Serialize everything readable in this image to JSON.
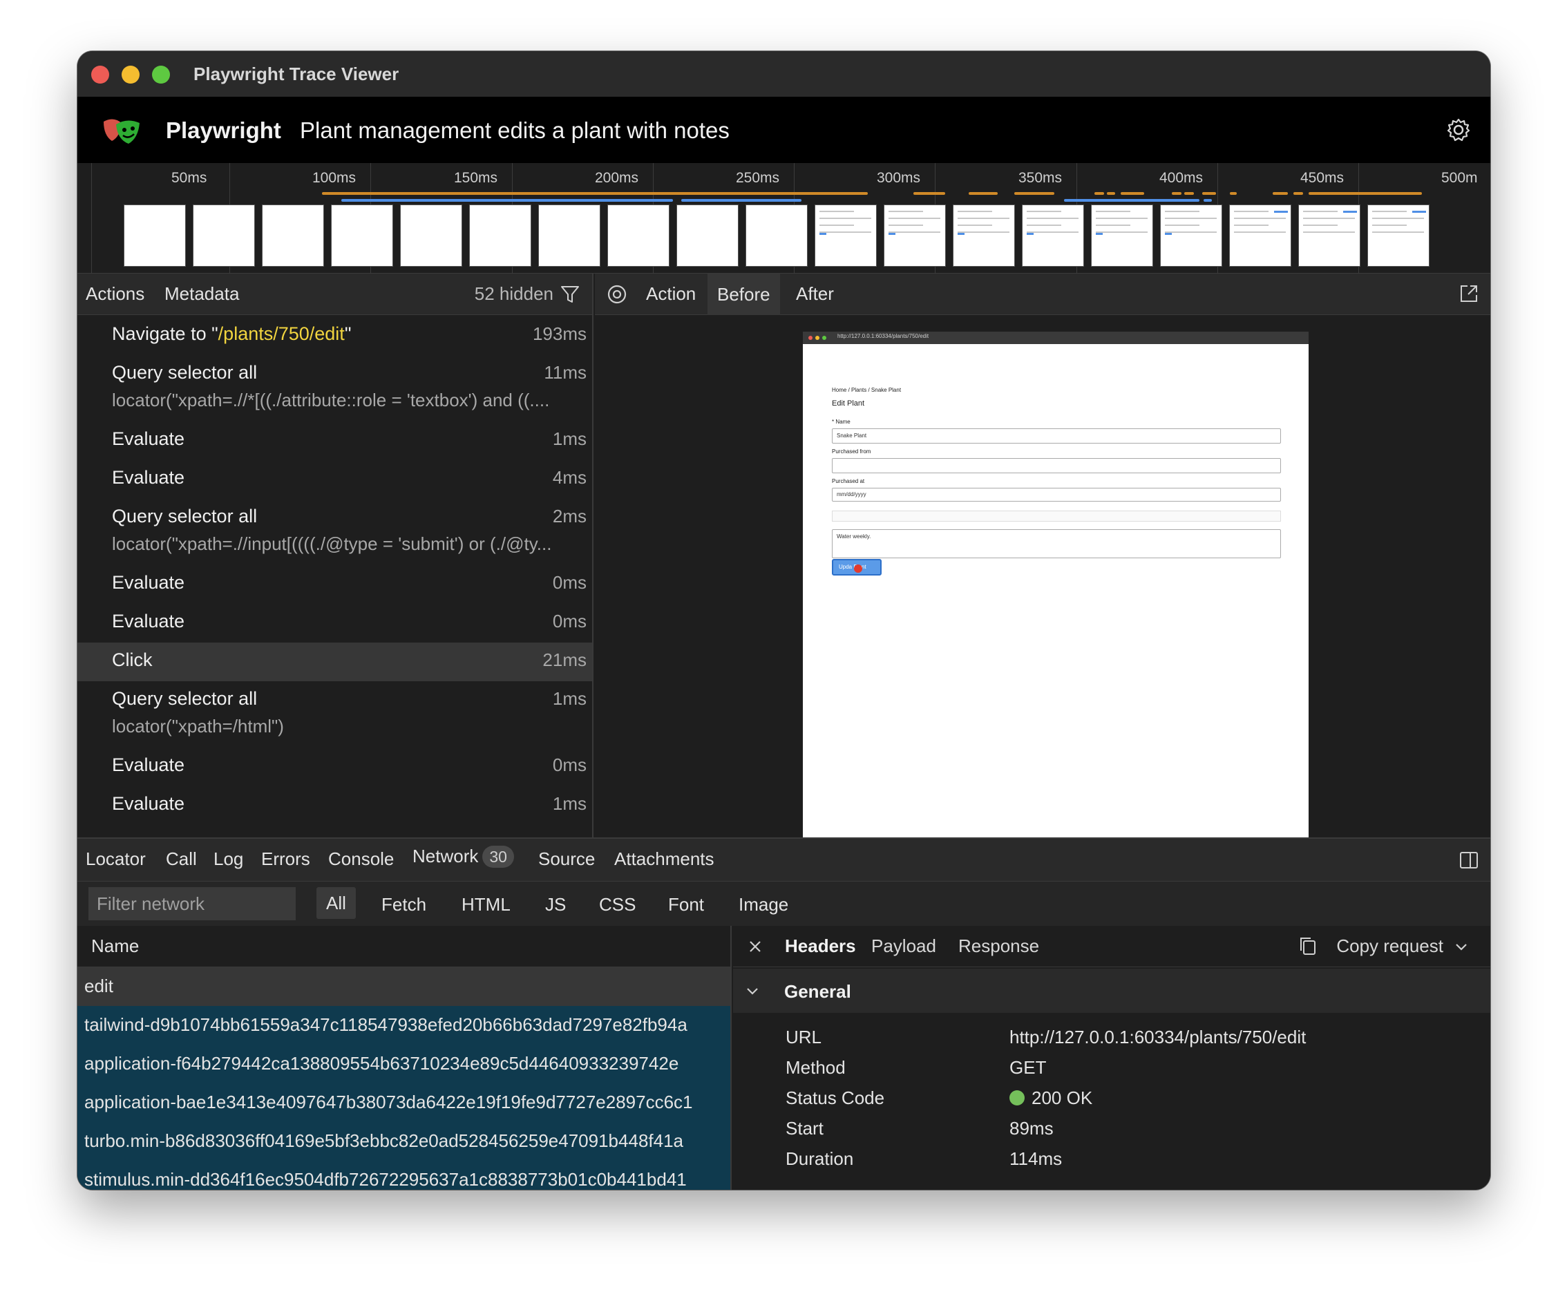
{
  "window": {
    "title": "Playwright Trace Viewer"
  },
  "header": {
    "brand": "Playwright",
    "test_title": "Plant management edits a plant with notes"
  },
  "timeline": {
    "ticks": [
      "50ms",
      "100ms",
      "150ms",
      "200ms",
      "250ms",
      "300ms",
      "350ms",
      "400ms",
      "450ms",
      "500m"
    ]
  },
  "left_tabs": {
    "actions": "Actions",
    "metadata": "Metadata",
    "hidden": "52 hidden"
  },
  "actions": [
    {
      "name_prefix": "Navigate to \"",
      "name_highlight": "/plants/750/edit",
      "name_suffix": "\"",
      "duration": "193ms"
    },
    {
      "name": "Query selector all",
      "duration": "11ms",
      "sub": "locator(\"xpath=.//*[((./attribute::role = 'textbox') and ((...."
    },
    {
      "name": "Evaluate",
      "duration": "1ms"
    },
    {
      "name": "Evaluate",
      "duration": "4ms"
    },
    {
      "name": "Query selector all",
      "duration": "2ms",
      "sub": "locator(\"xpath=.//input[((((./@type = 'submit') or (./@ty..."
    },
    {
      "name": "Evaluate",
      "duration": "0ms"
    },
    {
      "name": "Evaluate",
      "duration": "0ms"
    },
    {
      "name": "Click",
      "duration": "21ms"
    },
    {
      "name": "Query selector all",
      "duration": "1ms",
      "sub": "locator(\"xpath=/html\")"
    },
    {
      "name": "Evaluate",
      "duration": "0ms"
    },
    {
      "name": "Evaluate",
      "duration": "1ms"
    }
  ],
  "right_tabs": {
    "action": "Action",
    "before": "Before",
    "after": "After"
  },
  "snapshot": {
    "url": "http://127.0.0.1:60334/plants/750/edit",
    "breadcrumb": "Home / Plants / Snake Plant",
    "heading": "Edit Plant",
    "name_label": "* Name",
    "name_value": "Snake Plant",
    "purchased_from_label": "Purchased from",
    "purchased_at_label": "Purchased at",
    "purchased_at_placeholder": "mm/dd/yyyy",
    "notes_value": "Water weekly.",
    "submit_label": "Upda   Plant"
  },
  "bottom_tabs": {
    "locator": "Locator",
    "call": "Call",
    "log": "Log",
    "errors": "Errors",
    "console": "Console",
    "network": "Network",
    "network_count": "30",
    "source": "Source",
    "attachments": "Attachments"
  },
  "network_filter": {
    "placeholder": "Filter network",
    "types": [
      "All",
      "Fetch",
      "HTML",
      "JS",
      "CSS",
      "Font",
      "Image"
    ]
  },
  "network_list": {
    "column_name": "Name",
    "rows": [
      "edit",
      "tailwind-d9b1074bb61559a347c118547938efed20b66b63dad7297e82fb94a",
      "application-f64b279442ca138809554b63710234e89c5d44640933239742e",
      "application-bae1e3413e4097647b38073da6422e19f19fe9d7727e2897cc6c1",
      "turbo.min-b86d83036ff04169e5bf3ebbc82e0ad528456259e47091b448f41a",
      "stimulus.min-dd364f16ec9504dfb72672295637a1c8838773b01c0b441bd41"
    ]
  },
  "details": {
    "tabs": {
      "headers": "Headers",
      "payload": "Payload",
      "response": "Response"
    },
    "copy_request": "Copy request",
    "section": "General",
    "fields": [
      {
        "key": "URL",
        "value": "http://127.0.0.1:60334/plants/750/edit"
      },
      {
        "key": "Method",
        "value": "GET"
      },
      {
        "key": "Status Code",
        "value": "200 OK"
      },
      {
        "key": "Start",
        "value": "89ms"
      },
      {
        "key": "Duration",
        "value": "114ms"
      }
    ]
  },
  "colors": {
    "highlight": "#f1d43f",
    "status_ok": "#75c05b",
    "accent_blue": "#4f8fe6",
    "timeline_orange": "#d08a28"
  }
}
